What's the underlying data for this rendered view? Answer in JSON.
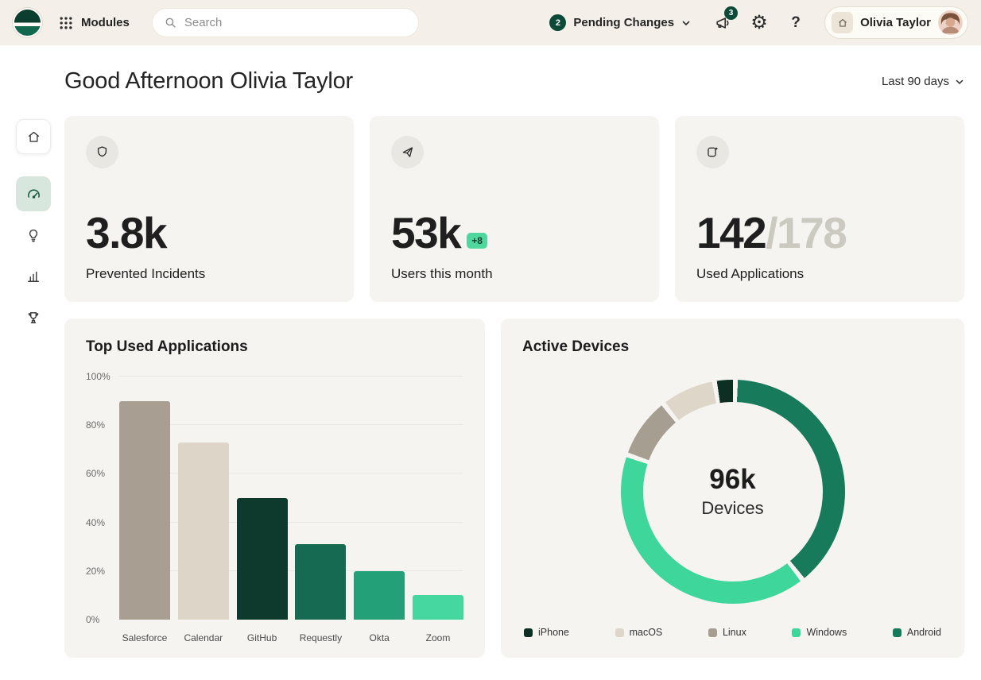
{
  "theme": {
    "topbar_bg": "#F4F0E9",
    "accent_dark_green": "#0C4A37",
    "mint": "#46D7A0",
    "card_bg": "#F5F4F1",
    "active_sidebar_bg": "#D7E7DD"
  },
  "topbar": {
    "modules_label": "Modules",
    "search_placeholder": "Search",
    "pending_changes": {
      "count": "2",
      "label": "Pending Changes"
    },
    "notifications_count": "3",
    "help_label": "?",
    "user_name": "Olivia Taylor"
  },
  "page": {
    "greeting": "Good Afternoon Olivia Taylor",
    "date_range": "Last 90 days"
  },
  "sidebar": {
    "items": [
      {
        "name": "home"
      },
      {
        "name": "dashboard",
        "active": true
      },
      {
        "name": "insights"
      },
      {
        "name": "reports"
      },
      {
        "name": "achievements"
      }
    ]
  },
  "stats": [
    {
      "icon": "shield-icon",
      "value": "3.8k",
      "label": "Prevented Incidents"
    },
    {
      "icon": "send-icon",
      "value": "53k",
      "badge": "+8",
      "label": "Users this month"
    },
    {
      "icon": "app-window-icon",
      "value": "142",
      "secondary": "/178",
      "label": "Used Applications"
    }
  ],
  "chart_data": [
    {
      "type": "bar",
      "title": "Top Used Applications",
      "categories": [
        "Salesforce",
        "Calendar",
        "GitHub",
        "Requestly",
        "Okta",
        "Zoom"
      ],
      "values": [
        90,
        73,
        50,
        31,
        20,
        10
      ],
      "colors": [
        "#A89E92",
        "#DDD5C7",
        "#0E3A2D",
        "#176A52",
        "#23A078",
        "#46D7A0"
      ],
      "ticks": [
        "0%",
        "20%",
        "40%",
        "60%",
        "80%",
        "100%"
      ],
      "ylim": [
        0,
        100
      ],
      "grid": true,
      "unit": "%"
    },
    {
      "type": "donut",
      "title": "Active Devices",
      "center_value": "96k",
      "center_label": "Devices",
      "segments": [
        {
          "name": "Android",
          "value": 39,
          "color": "#177A5B"
        },
        {
          "name": "Windows",
          "value": 41,
          "color": "#3ED69B"
        },
        {
          "name": "Linux",
          "value": 9,
          "color": "#A79E92"
        },
        {
          "name": "macOS",
          "value": 8,
          "color": "#DED7C9"
        },
        {
          "name": "iPhone",
          "value": 3,
          "color": "#0C2E23"
        }
      ],
      "legend": [
        {
          "name": "iPhone",
          "color": "#0C2E23"
        },
        {
          "name": "macOS",
          "color": "#DED7C9"
        },
        {
          "name": "Linux",
          "color": "#A79E92"
        },
        {
          "name": "Windows",
          "color": "#3ED69B"
        },
        {
          "name": "Android",
          "color": "#177A5B"
        }
      ],
      "legend_position": "bottom"
    }
  ]
}
